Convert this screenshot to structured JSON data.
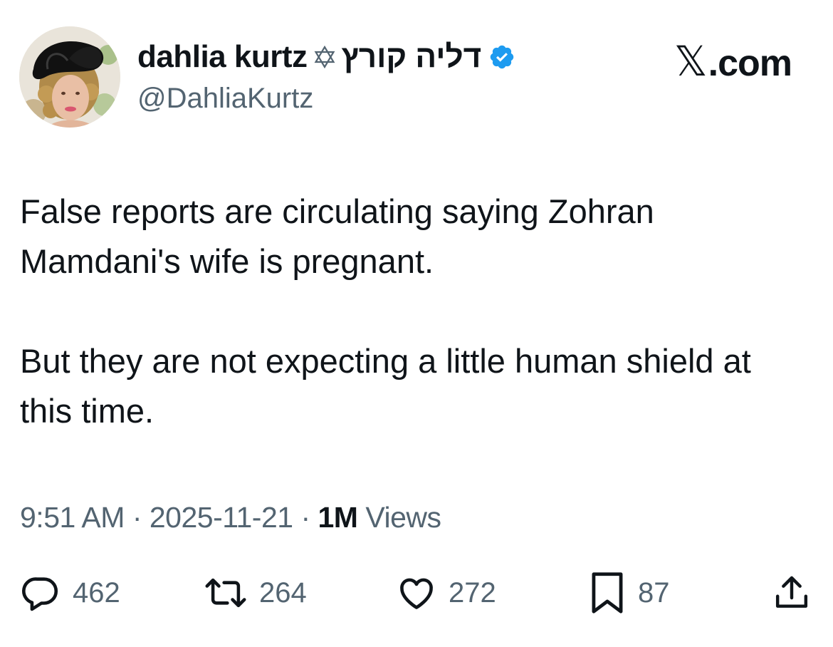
{
  "author": {
    "display_name": "dahlia kurtz",
    "hebrew_name": "דליה קורץ",
    "handle": "@DahliaKurtz",
    "verified": true,
    "star_icon": "star-of-david-icon",
    "verified_icon": "verified-badge-icon",
    "verified_color": "#1d9bf0"
  },
  "brand": {
    "x_mark": "𝕏",
    "domain": ".com"
  },
  "tweet": {
    "paragraphs": [
      "False reports are circulating saying Zohran Mamdani's wife is pregnant.",
      "But they are not expecting a little human shield at this time."
    ]
  },
  "meta": {
    "time": "9:51 AM",
    "separator": " · ",
    "date": "2025-11-21",
    "views_count": "1M",
    "views_label": " Views"
  },
  "actions": {
    "reply": {
      "icon": "reply-icon",
      "count": "462"
    },
    "retweet": {
      "icon": "retweet-icon",
      "count": "264"
    },
    "like": {
      "icon": "heart-icon",
      "count": "272"
    },
    "bookmark": {
      "icon": "bookmark-icon",
      "count": "87"
    },
    "share": {
      "icon": "share-icon"
    }
  },
  "colors": {
    "text_primary": "#0f1419",
    "text_secondary": "#536471",
    "icon_gray": "#536471"
  }
}
